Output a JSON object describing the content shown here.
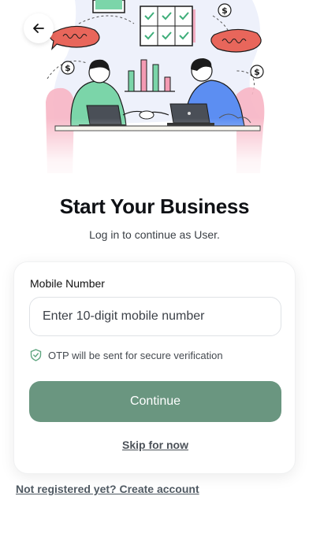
{
  "header": {
    "back_icon": "arrow-left-icon"
  },
  "hero": {
    "illustration": "business-meeting-illustration",
    "colors": {
      "green": "#7bd5a9",
      "pink": "#f49bb3",
      "red": "#e8665b",
      "blue": "#5c8ef2",
      "cream": "#f5f3ea"
    }
  },
  "page": {
    "title": "Start Your Business",
    "subtitle": "Log in to continue as User."
  },
  "form": {
    "mobile_label": "Mobile Number",
    "mobile_placeholder": "Enter 10-digit mobile number",
    "mobile_value": "",
    "otp_note": "OTP will be sent for secure verification",
    "otp_icon": "shield-check-icon",
    "continue_label": "Continue",
    "skip_label": "Skip for now"
  },
  "footer": {
    "register_label": "Not registered yet? Create account"
  },
  "theme": {
    "accent": "#6a9680",
    "text": "#0f1115",
    "muted": "#4f5962"
  }
}
